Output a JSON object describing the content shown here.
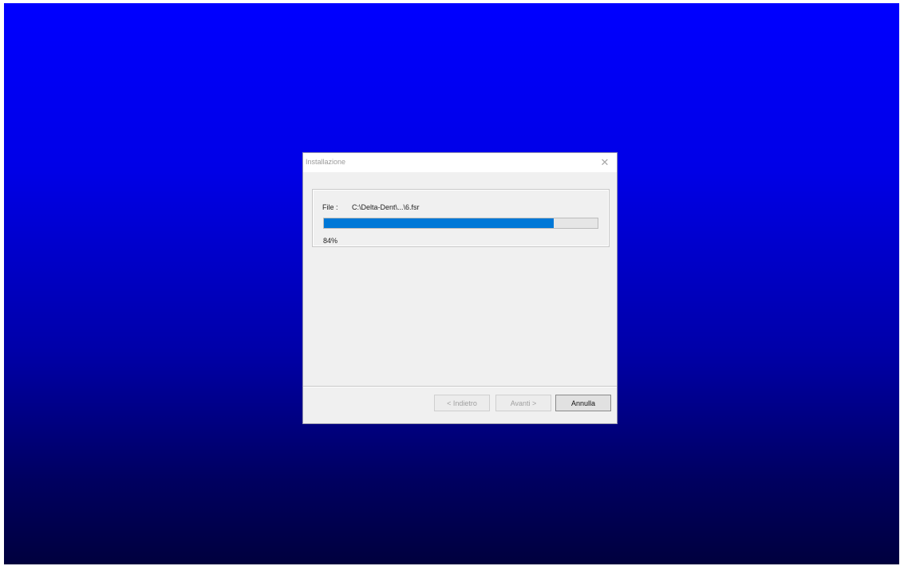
{
  "desktop": {
    "background_top_color": "#0000ff",
    "background_bottom_color": "#00003e"
  },
  "dialog": {
    "title": "Installazione",
    "close_icon": "close-icon",
    "file_label": "File :",
    "file_path": "C:\\Delta-Dent\\...\\6.fsr",
    "progress_fraction": 0.84,
    "progress_text": "84%",
    "progress_color": "#0078d7",
    "buttons": {
      "back_label": "< Indietro",
      "next_label": "Avanti >",
      "cancel_label": "Annulla"
    }
  }
}
